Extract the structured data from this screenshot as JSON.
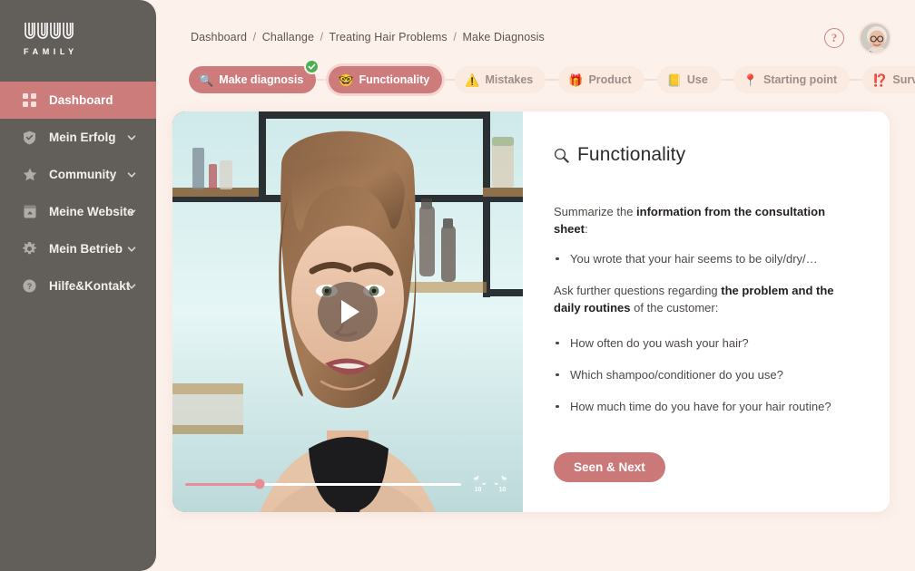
{
  "brand": {
    "logo_text": "WOW",
    "logo_sub": "FAMILY"
  },
  "sidebar": {
    "items": [
      {
        "label": "Dashboard",
        "icon": "grid-icon",
        "active": true,
        "chevron": false
      },
      {
        "label": "Mein Erfolg",
        "icon": "shield-check-icon",
        "active": false,
        "chevron": true
      },
      {
        "label": "Community",
        "icon": "star-icon",
        "active": false,
        "chevron": true
      },
      {
        "label": "Meine Website",
        "icon": "browser-icon",
        "active": false,
        "chevron": true
      },
      {
        "label": "Mein Betrieb",
        "icon": "gear-icon",
        "active": false,
        "chevron": true
      },
      {
        "label": "Hilfe&Kontakt",
        "icon": "question-circle-icon",
        "active": false,
        "chevron": true
      }
    ]
  },
  "breadcrumb": {
    "items": [
      "Dashboard",
      "Challange",
      "Treating Hair Problems",
      "Make Diagnosis"
    ],
    "separator": "/"
  },
  "topbar": {
    "help_label": "?",
    "avatar_name": "user-avatar"
  },
  "steps": [
    {
      "label": "Make diagnosis",
      "icon": "🔍",
      "state": "done",
      "check": true
    },
    {
      "label": "Functionality",
      "icon": "🤓",
      "state": "current",
      "check": false
    },
    {
      "label": "Mistakes",
      "icon": "⚠️",
      "state": "upcoming",
      "check": false
    },
    {
      "label": "Product",
      "icon": "🎁",
      "state": "upcoming",
      "check": false
    },
    {
      "label": "Use",
      "icon": "📒",
      "state": "upcoming",
      "check": false
    },
    {
      "label": "Starting point",
      "icon": "📍",
      "state": "upcoming",
      "check": false
    },
    {
      "label": "Survey",
      "icon": "⁉️",
      "state": "upcoming",
      "check": false
    }
  ],
  "video": {
    "play_label": "play-button",
    "progress_percent": 27,
    "rewind_label": "10",
    "forward_label": "10"
  },
  "content": {
    "title": "Functionality",
    "title_icon": "magnifier-icon",
    "intro_prefix": "Summarize the ",
    "intro_bold": "information from the consultation sheet",
    "intro_suffix": ":",
    "first_bullets": [
      "You wrote that your hair seems to be oily/dry/…"
    ],
    "ask_prefix": "Ask further questions regarding ",
    "ask_bold": "the problem and the daily routines",
    "ask_suffix": " of the customer:",
    "questions": [
      "How often do you wash your hair?",
      "Which shampoo/conditioner do you use?",
      "How much time do you have for your hair routine?"
    ],
    "cta_label": "Seen & Next"
  },
  "colors": {
    "page_bg": "#fdf1ec",
    "sidebar_bg": "#625f5b",
    "accent_rose": "#cd7b7b",
    "pill_inactive_bg": "#fbeadf",
    "check_green": "#4caf50",
    "progress_pink": "#e98d94"
  }
}
